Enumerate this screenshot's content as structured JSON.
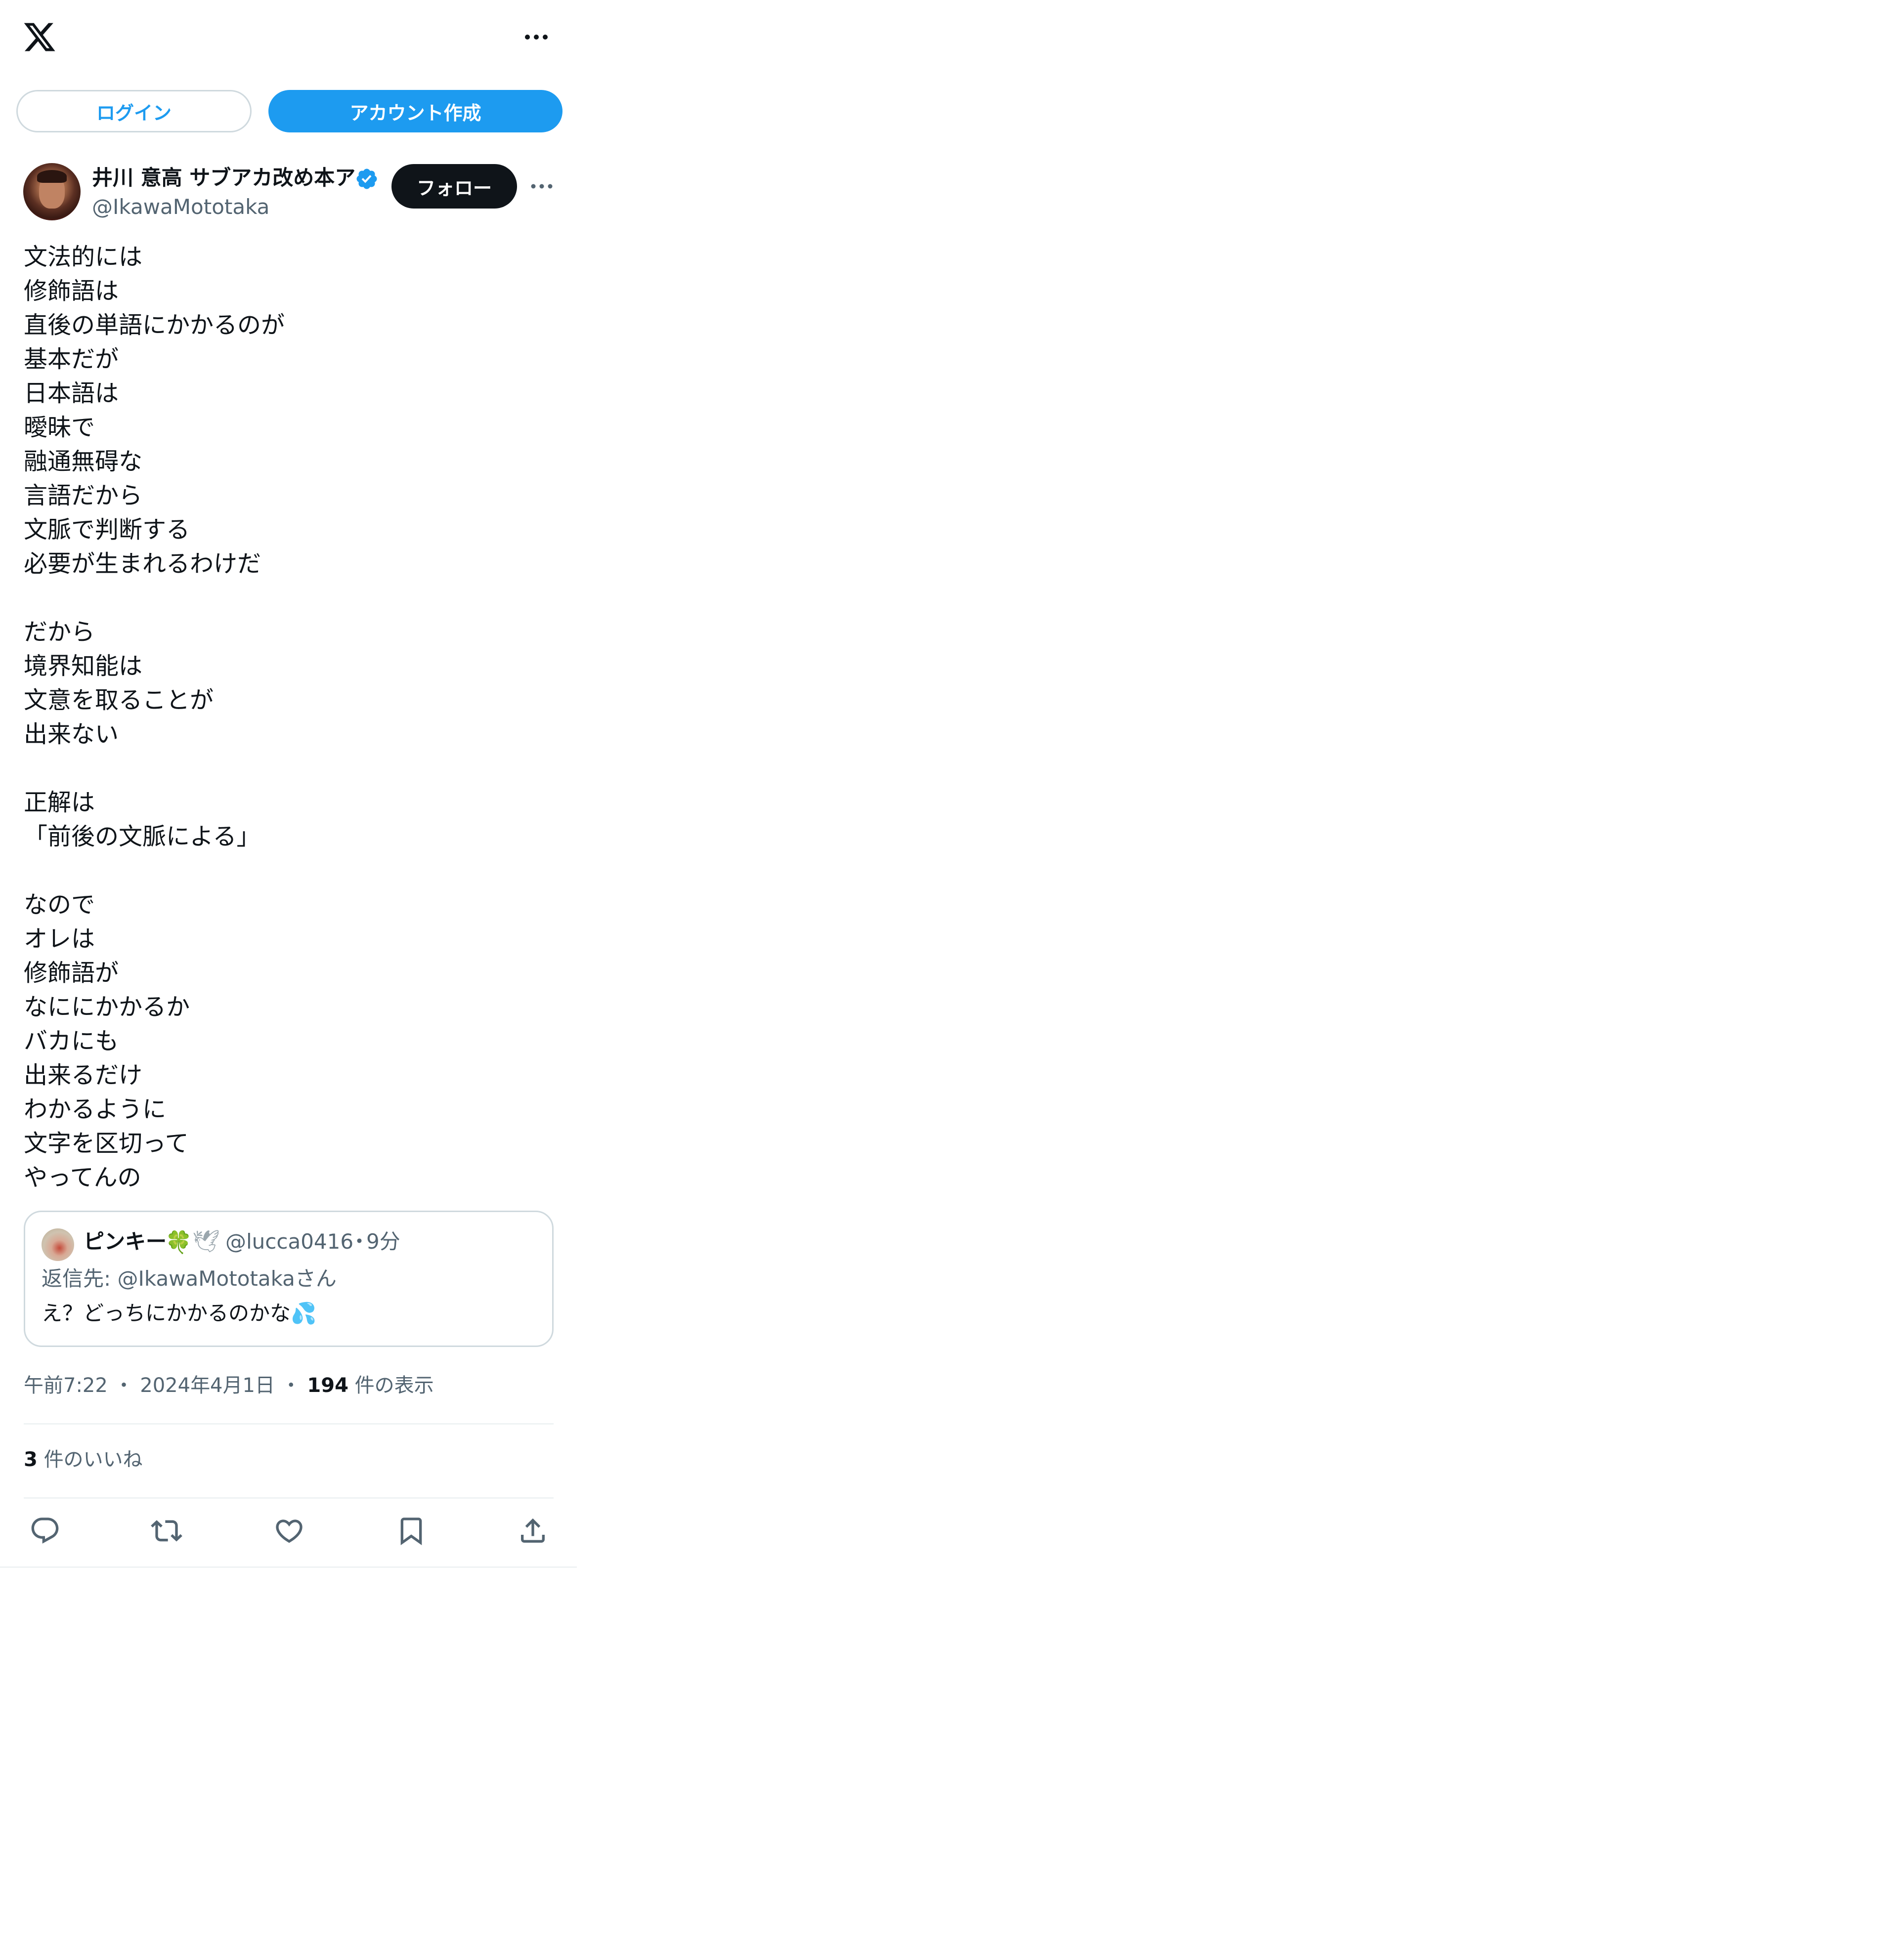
{
  "header": {
    "logo": "x-logo-icon",
    "more": "more-horizontal-icon"
  },
  "auth": {
    "login_label": "ログイン",
    "signup_label": "アカウント作成",
    "accent_color": "#1d9bf0"
  },
  "author": {
    "name": "井川 意高 サブアカ改め本ア",
    "handle": "@IkawaMototaka",
    "verified": true,
    "follow_label": "フォロー"
  },
  "tweet": {
    "text": "文法的には\n修飾語は\n直後の単語にかかるのが\n基本だが\n日本語は\n曖昧で\n融通無碍な\n言語だから\n文脈で判断する\n必要が生まれるわけだ\n\nだから\n境界知能は\n文意を取ることが\n出来ない\n\n正解は\n「前後の文脈による」\n\nなので\nオレは\n修飾語が\nなににかかるか\nバカにも\n出来るだけ\nわかるように\n文字を区切って\nやってんの"
  },
  "quoted": {
    "name": "ピンキー",
    "name_emoji_1": "🍀",
    "name_emoji_2": "🕊",
    "handle": "@lucca0416",
    "separator": "・",
    "time": "9分",
    "replying_to": "返信先: @IkawaMototakaさん",
    "text": "え？どっちにかかるのかな💦"
  },
  "meta": {
    "time": "午前7:22",
    "separator": "・",
    "date": "2024年4月1日",
    "views_count": "194",
    "views_label": "件の表示"
  },
  "likes": {
    "count": "3",
    "label": "件のいいね"
  },
  "actions": [
    "reply-icon",
    "retweet-icon",
    "like-icon",
    "bookmark-icon",
    "share-icon"
  ]
}
